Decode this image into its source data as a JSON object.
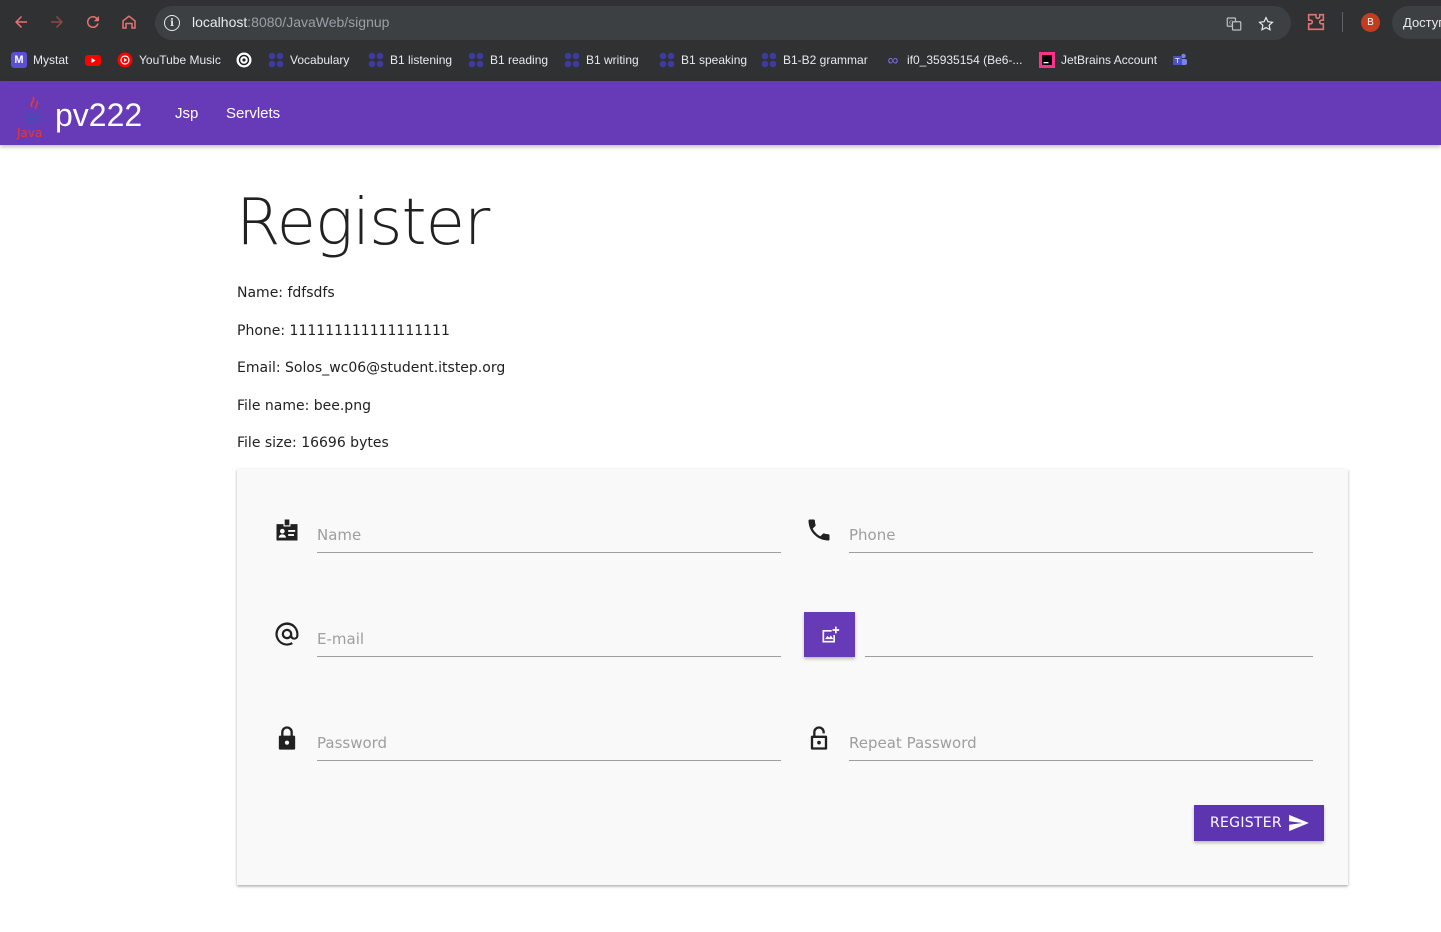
{
  "browser": {
    "url_host": "localhost",
    "url_path": ":8080/JavaWeb/signup",
    "access_label": "Доступ",
    "profile_initial": "B",
    "bookmarks": [
      {
        "label": "Mystat",
        "icon": "mystat-icon"
      },
      {
        "label": "",
        "icon": "youtube-icon"
      },
      {
        "label": "YouTube Music",
        "icon": "youtube-music-icon"
      },
      {
        "label": "",
        "icon": "openai-icon"
      },
      {
        "label": "Vocabulary",
        "icon": "dots-icon"
      },
      {
        "label": "B1 listening",
        "icon": "dots-icon"
      },
      {
        "label": "B1 reading",
        "icon": "dots-icon"
      },
      {
        "label": "B1 writing",
        "icon": "dots-icon"
      },
      {
        "label": "B1 speaking",
        "icon": "dots-icon"
      },
      {
        "label": "B1-B2 grammar",
        "icon": "dots-icon"
      },
      {
        "label": "if0_35935154 (Be6-...",
        "icon": "infinity-icon"
      },
      {
        "label": "JetBrains Account",
        "icon": "jetbrains-icon"
      },
      {
        "label": "",
        "icon": "teams-icon"
      }
    ]
  },
  "navbar": {
    "brand": "pv222",
    "logo_text": "Java",
    "links": [
      "Jsp",
      "Servlets"
    ],
    "color": "#673ab7"
  },
  "page": {
    "title": "Register",
    "info": [
      "Name: fdfsdfs",
      "Phone: 111111111111111111",
      "Email: Solos_wc06@student.itstep.org",
      "File name: bee.png",
      "File size: 16696 bytes"
    ]
  },
  "form": {
    "name_placeholder": "Name",
    "phone_placeholder": "Phone",
    "email_placeholder": "E-mail",
    "password_placeholder": "Password",
    "repeat_password_placeholder": "Repeat Password",
    "submit_label": "REGISTER"
  }
}
